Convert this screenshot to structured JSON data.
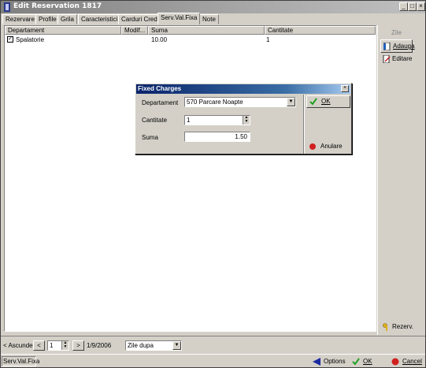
{
  "window": {
    "title": "Edit Reservation 1817",
    "minimize": "_",
    "maximize": "□",
    "close": "×"
  },
  "tabs": [
    "Rezervare",
    "Profile",
    "Grila",
    "Caracteristici",
    "Carduri Credit",
    "Serv.Val.Fixa",
    "Note"
  ],
  "active_tab": "Serv.Val.Fixa",
  "grid": {
    "columns": [
      "Departament",
      "Modif...",
      "Suma",
      "Cantitate"
    ],
    "rows": [
      {
        "checked": true,
        "departament": "Spalatorie",
        "modif": "",
        "suma": "10.00",
        "cantitate": "1"
      }
    ]
  },
  "right_panel": {
    "zile": "Zile",
    "adauga": "Adauga",
    "editare": "Editare",
    "rezerv": "Rezerv."
  },
  "bottom": {
    "ascunde": "< Ascunde",
    "prev": "<",
    "count": "1",
    "next": ">",
    "date": "1/9/2006",
    "mode": "Zile dupa"
  },
  "status": {
    "section": "Serv.Val.Fixa",
    "options": "Options",
    "ok": "OK",
    "cancel": "Cancel"
  },
  "dialog": {
    "title": "Fixed Charges",
    "departament_label": "Departament",
    "departament_value": "570   Parcare Noapte",
    "cantitate_label": "Cantitate",
    "cantitate_value": "1",
    "suma_label": "Suma",
    "suma_value": "1.50",
    "ok": "OK",
    "anulare": "Anulare"
  },
  "colors": {
    "titlebar": "#808080",
    "dialog_titlebar": "#0a246a",
    "window_bg": "#d4d0c8"
  }
}
